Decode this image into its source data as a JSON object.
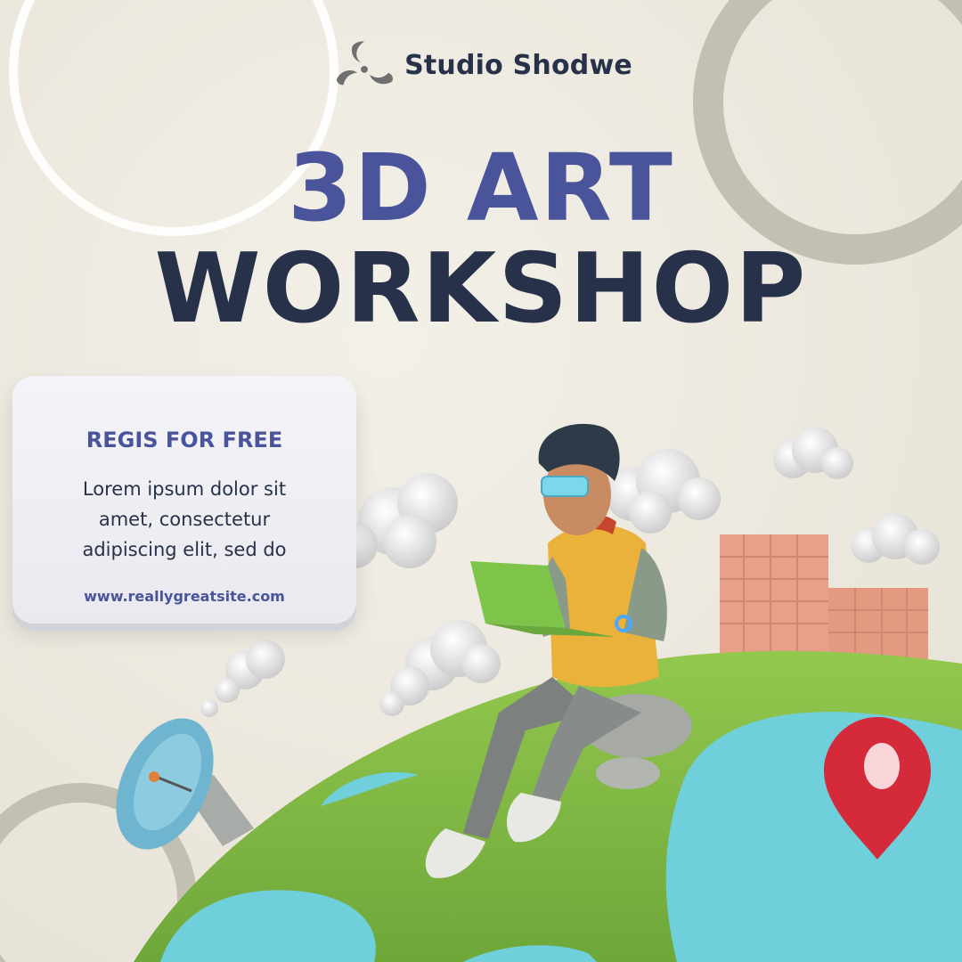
{
  "brand": {
    "name": "Studio Shodwe",
    "logo_icon": "swirl-logo-icon"
  },
  "headline": {
    "line1": "3D ART",
    "line2": "WORKSHOP"
  },
  "info_card": {
    "heading": "REGIS FOR FREE",
    "body": "Lorem ipsum dolor sit amet, consectetur adipiscing elit, sed do",
    "website": "www.reallygreatsite.com"
  },
  "colors": {
    "background": "#ece8df",
    "accent_indigo": "#4a549a",
    "dark_navy": "#27324a",
    "grass_green": "#8cc24a",
    "water_cyan": "#6fd0dc",
    "pin_red": "#d42a3a",
    "building_salmon": "#e8a088"
  },
  "illustration": {
    "icons": [
      "cloud-icon",
      "satellite-dish-icon",
      "location-pin-icon",
      "building-icon",
      "laptop-icon",
      "person-figure"
    ]
  }
}
